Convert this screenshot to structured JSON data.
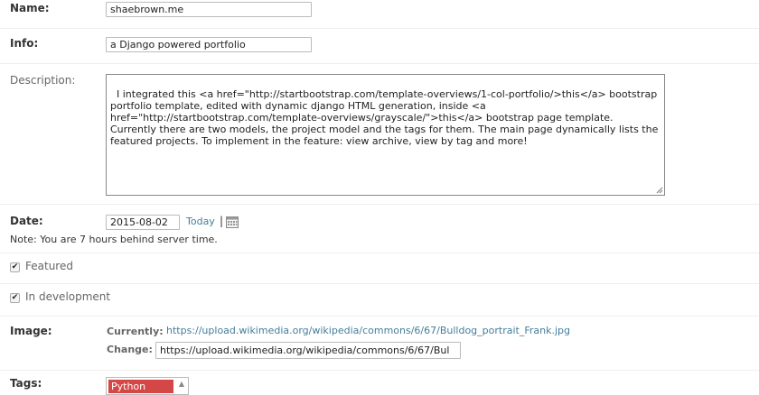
{
  "name": {
    "label": "Name:",
    "value": "shaebrown.me"
  },
  "info": {
    "label": "Info:",
    "value": "a Django powered portfolio"
  },
  "description": {
    "label": "Description:",
    "value": "I integrated this <a href=\"http://startbootstrap.com/template-overviews/1-col-portfolio/>this</a> bootstrap portfolio template, edited with dynamic django HTML generation, inside <a href=\"http://startbootstrap.com/template-overviews/grayscale/\">this</a> bootstrap page template. Currently there are two models, the project model and the tags for them. The main page dynamically lists the featured projects. To implement in the feature: view archive, view by tag and more!"
  },
  "date": {
    "label": "Date:",
    "value": "2015-08-02",
    "today_link": "Today",
    "separator": "|",
    "calendar_icon": "calendar-icon",
    "note": "Note: You are 7 hours behind server time."
  },
  "featured": {
    "label": "Featured",
    "checked": true
  },
  "in_development": {
    "label": "In development",
    "checked": true
  },
  "image": {
    "label": "Image:",
    "currently_label": "Currently:",
    "currently_link": "https://upload.wikimedia.org/wikipedia/commons/6/67/Bulldog_portrait_Frank.jpg",
    "change_label": "Change:",
    "change_value": "https://upload.wikimedia.org/wikipedia/commons/6/67/Bul"
  },
  "tags": {
    "label": "Tags:",
    "options": [
      "Python"
    ]
  },
  "colors": {
    "accent_link": "#447e9b",
    "selected_tag": "#d54747"
  }
}
